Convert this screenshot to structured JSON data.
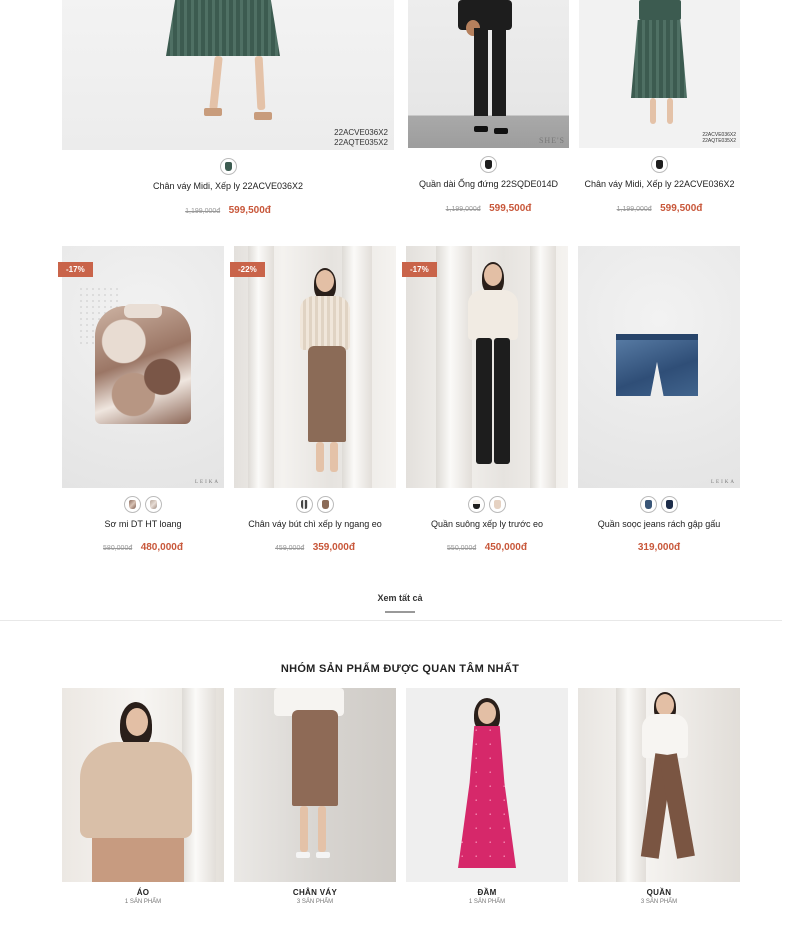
{
  "top_products": [
    {
      "name": "Chân váy Midi, Xếp ly 22ACVE036X2",
      "old_price": "1,199,000đ",
      "price": "599,500đ",
      "code": [
        "22ACVE036X2",
        "22AQTE035X2"
      ]
    },
    {
      "name": "Quần dài Ống đứng 22SQDE014D",
      "old_price": "1,199,000đ",
      "price": "599,500đ",
      "brand": "SHE'S"
    },
    {
      "name": "Chân váy Midi, Xếp ly 22ACVE036X2",
      "old_price": "1,199,000đ",
      "price": "599,500đ",
      "code": [
        "22ACVE036X2",
        "22AQTE035X2"
      ]
    }
  ],
  "products": [
    {
      "name": "Sơ mi DT HT loang",
      "badge": "-17%",
      "old_price": "580,000đ",
      "price": "480,000đ",
      "swatches": [
        "print",
        "print-light"
      ],
      "brand": "LEIKA"
    },
    {
      "name": "Chân váy bút chì xếp ly ngang eo",
      "badge": "-22%",
      "old_price": "459,000đ",
      "price": "359,000đ",
      "swatches": [
        "stripe",
        "brown"
      ]
    },
    {
      "name": "Quần suông xếp ly trước eo",
      "badge": "-17%",
      "old_price": "550,000đ",
      "price": "450,000đ",
      "swatches": [
        "black-white",
        "cream"
      ]
    },
    {
      "name": "Quần soọc jeans rách gập gấu",
      "price": "319,000đ",
      "swatches": [
        "denim",
        "navy"
      ],
      "brand": "LEIKA"
    }
  ],
  "view_all": "Xem tất cả",
  "categories_title": "NHÓM SẢN PHẨM ĐƯỢC QUAN TÂM NHẤT",
  "categories": [
    {
      "name": "ÁO",
      "count": "1 SẢN PHẨM"
    },
    {
      "name": "CHÂN VÁY",
      "count": "3 SẢN PHẨM"
    },
    {
      "name": "ĐẦM",
      "count": "1 SẢN PHẨM"
    },
    {
      "name": "QUẦN",
      "count": "3 SẢN PHẨM"
    }
  ],
  "colors": {
    "price": "#c8573a",
    "badge": "#c9644a"
  }
}
